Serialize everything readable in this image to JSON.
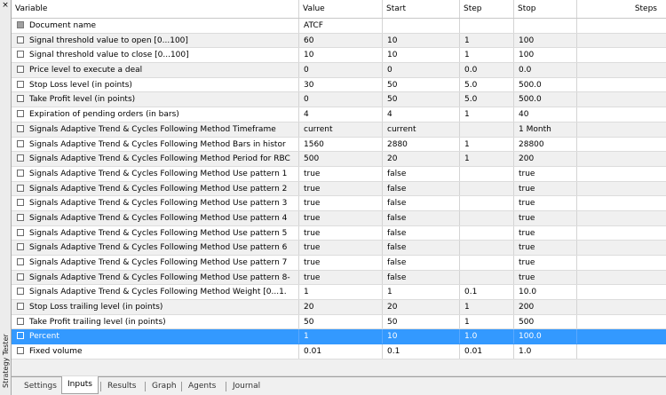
{
  "sidebar": {
    "label": "Strategy Tester",
    "close_glyph": "×"
  },
  "columns": {
    "variable": "Variable",
    "value": "Value",
    "start": "Start",
    "step": "Step",
    "stop": "Stop",
    "steps": "Steps"
  },
  "rows": [
    {
      "variable": "Document name",
      "value": "ATCF",
      "start": "",
      "step": "",
      "stop": "",
      "steps": "",
      "checkbox": "gray"
    },
    {
      "variable": "Signal threshold value to open [0...100]",
      "value": "60",
      "start": "10",
      "step": "1",
      "stop": "100",
      "steps": ""
    },
    {
      "variable": "Signal threshold value to close [0...100]",
      "value": "10",
      "start": "10",
      "step": "1",
      "stop": "100",
      "steps": ""
    },
    {
      "variable": "Price level to execute a deal",
      "value": "0",
      "start": "0",
      "step": "0.0",
      "stop": "0.0",
      "steps": ""
    },
    {
      "variable": "Stop Loss level (in points)",
      "value": "30",
      "start": "50",
      "step": "5.0",
      "stop": "500.0",
      "steps": ""
    },
    {
      "variable": "Take Profit level (in points)",
      "value": "0",
      "start": "50",
      "step": "5.0",
      "stop": "500.0",
      "steps": ""
    },
    {
      "variable": "Expiration of pending orders (in bars)",
      "value": "4",
      "start": "4",
      "step": "1",
      "stop": "40",
      "steps": ""
    },
    {
      "variable": "Signals Adaptive Trend & Cycles Following Method Timeframe",
      "value": "current",
      "start": "current",
      "step": "",
      "stop": "1 Month",
      "steps": ""
    },
    {
      "variable": "Signals Adaptive Trend & Cycles Following Method Bars in histor",
      "value": "1560",
      "start": "2880",
      "step": "1",
      "stop": "28800",
      "steps": ""
    },
    {
      "variable": "Signals Adaptive Trend & Cycles Following Method Period for RBC",
      "value": "500",
      "start": "20",
      "step": "1",
      "stop": "200",
      "steps": ""
    },
    {
      "variable": "Signals Adaptive Trend & Cycles Following Method Use pattern 1",
      "value": "true",
      "start": "false",
      "step": "",
      "stop": "true",
      "steps": ""
    },
    {
      "variable": "Signals Adaptive Trend & Cycles Following Method Use pattern 2",
      "value": "true",
      "start": "false",
      "step": "",
      "stop": "true",
      "steps": ""
    },
    {
      "variable": "Signals Adaptive Trend & Cycles Following Method Use pattern 3",
      "value": "true",
      "start": "false",
      "step": "",
      "stop": "true",
      "steps": ""
    },
    {
      "variable": "Signals Adaptive Trend & Cycles Following Method Use pattern 4",
      "value": "true",
      "start": "false",
      "step": "",
      "stop": "true",
      "steps": ""
    },
    {
      "variable": "Signals Adaptive Trend & Cycles Following Method Use pattern 5",
      "value": "true",
      "start": "false",
      "step": "",
      "stop": "true",
      "steps": ""
    },
    {
      "variable": "Signals Adaptive Trend & Cycles Following Method Use pattern 6",
      "value": "true",
      "start": "false",
      "step": "",
      "stop": "true",
      "steps": ""
    },
    {
      "variable": "Signals Adaptive Trend & Cycles Following Method Use pattern 7",
      "value": "true",
      "start": "false",
      "step": "",
      "stop": "true",
      "steps": ""
    },
    {
      "variable": "Signals Adaptive Trend & Cycles Following Method Use pattern 8-",
      "value": "true",
      "start": "false",
      "step": "",
      "stop": "true",
      "steps": ""
    },
    {
      "variable": "Signals Adaptive Trend & Cycles Following Method Weight [0...1.",
      "value": "1",
      "start": "1",
      "step": "0.1",
      "stop": "10.0",
      "steps": ""
    },
    {
      "variable": "Stop Loss trailing level (in points)",
      "value": "20",
      "start": "20",
      "step": "1",
      "stop": "200",
      "steps": ""
    },
    {
      "variable": "Take Profit trailing level (in points)",
      "value": "50",
      "start": "50",
      "step": "1",
      "stop": "500",
      "steps": ""
    },
    {
      "variable": "Percent",
      "value": "1",
      "start": "10",
      "step": "1.0",
      "stop": "100.0",
      "steps": "",
      "selected": true
    },
    {
      "variable": "Fixed volume",
      "value": "0.01",
      "start": "0.1",
      "step": "0.01",
      "stop": "1.0",
      "steps": ""
    }
  ],
  "tabs": [
    {
      "label": "Settings",
      "active": false
    },
    {
      "label": "Inputs",
      "active": true
    },
    {
      "label": "Results",
      "active": false
    },
    {
      "label": "Graph",
      "active": false
    },
    {
      "label": "Agents",
      "active": false
    },
    {
      "label": "Journal",
      "active": false
    }
  ],
  "colors": {
    "selection": "#3399ff",
    "alt_row": "#f0f0f0"
  }
}
